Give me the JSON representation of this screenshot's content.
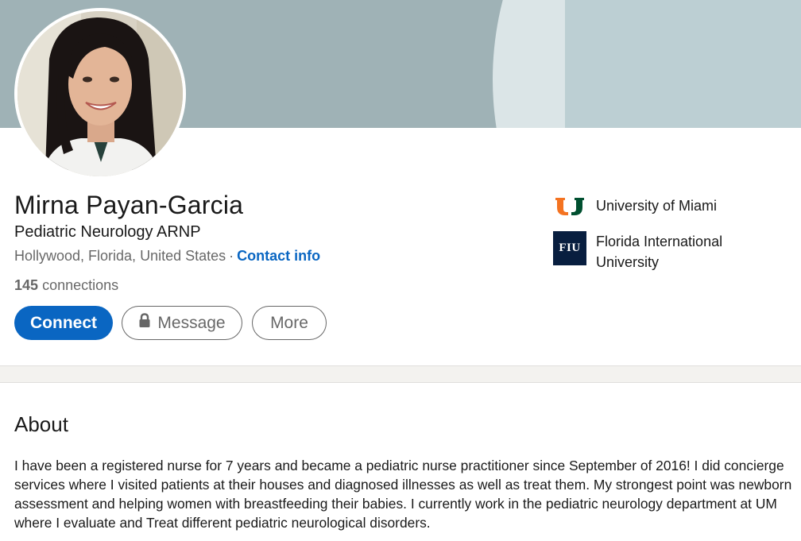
{
  "profile": {
    "name": "Mirna Payan-Garcia",
    "headline": "Pediatric Neurology ARNP",
    "location": "Hollywood, Florida, United States",
    "separator": "·",
    "contact_info": "Contact info",
    "connections_count": "145",
    "connections_label": "connections"
  },
  "actions": {
    "connect": "Connect",
    "message": "Message",
    "more": "More"
  },
  "education": [
    {
      "name": "University of Miami",
      "logo_icon": "university-of-miami-logo"
    },
    {
      "name": "Florida International University",
      "logo_text": "FIU",
      "logo_icon": "fiu-logo"
    }
  ],
  "about": {
    "title": "About",
    "text": "I have been a registered nurse for 7 years and became a pediatric nurse practitioner since September of 2016! I did concierge services where I visited patients at their houses and diagnosed illnesses as well as treat them. My strongest point was newborn assessment and helping women with breastfeeding their babies. I currently work in the pediatric neurology department at UM where I evaluate and Treat different pediatric neurological disorders."
  },
  "colors": {
    "accent": "#0a66c2",
    "banner": "#9fb2b6",
    "um_orange": "#f47321",
    "um_green": "#005030",
    "fiu_navy": "#081e3f"
  }
}
